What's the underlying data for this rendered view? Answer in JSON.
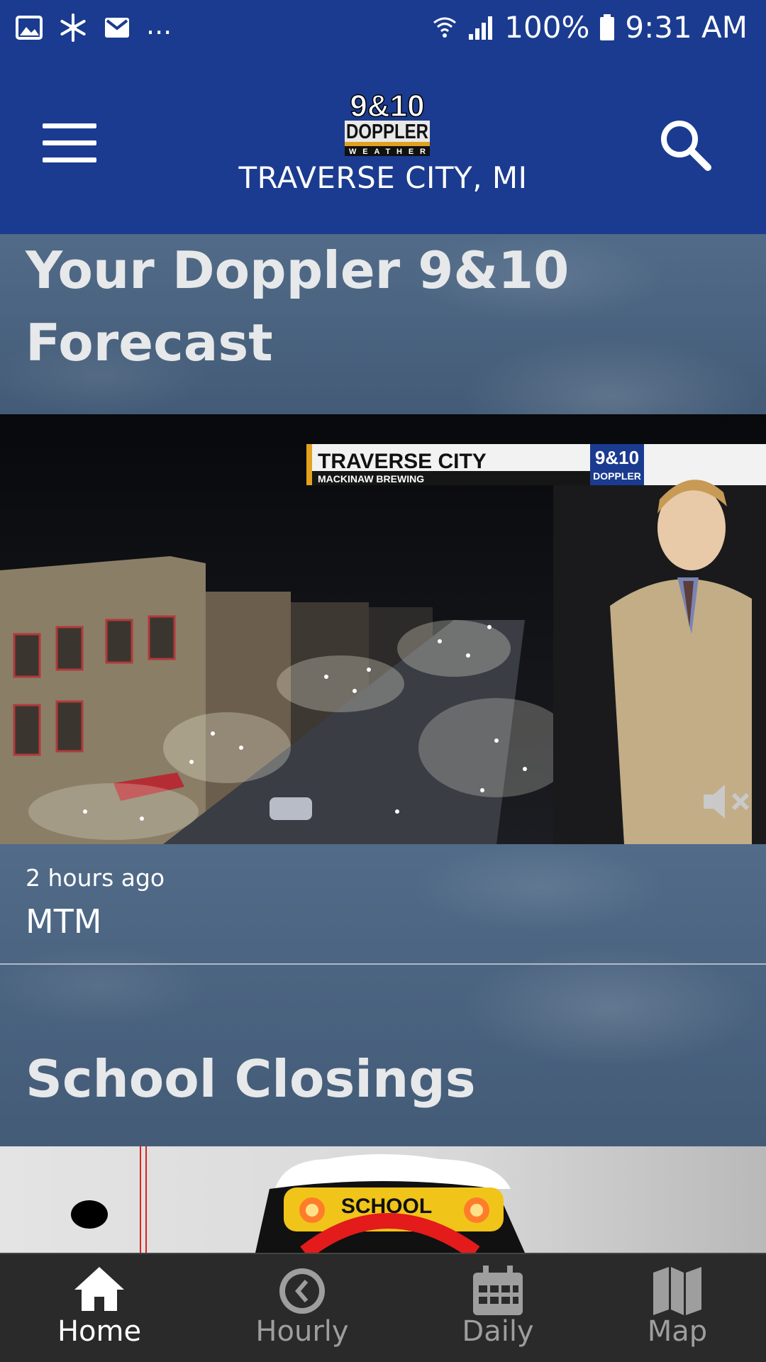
{
  "status_bar": {
    "battery": "100%",
    "time": "9:31 AM",
    "more": "..."
  },
  "header": {
    "logo_text": {
      "line1": "9&10",
      "line2": "DOPPLER",
      "line3": "WEATHER"
    },
    "location": "TRAVERSE CITY, MI"
  },
  "forecast": {
    "title_line1": "Your Doppler 9&10",
    "title_line2": "Forecast",
    "video": {
      "lower_third_title": "TRAVERSE CITY",
      "lower_third_sub": "MACKINAW BREWING",
      "channel_bug_line1": "9&10",
      "channel_bug_line2": "DOPPLER"
    },
    "time_ago": "2 hours ago",
    "video_title": "MTM"
  },
  "school_closings": {
    "title": "School Closings",
    "bus_sign": "SCHOOL"
  },
  "bottom_nav": {
    "items": [
      {
        "label": "Home",
        "icon": "home-icon",
        "active": true
      },
      {
        "label": "Hourly",
        "icon": "clock-icon",
        "active": false
      },
      {
        "label": "Daily",
        "icon": "calendar-icon",
        "active": false
      },
      {
        "label": "Map",
        "icon": "map-icon",
        "active": false
      }
    ]
  },
  "colors": {
    "brand_blue": "#1a3b8f",
    "sky": "#47607c",
    "nav_bg": "#2a2a2a"
  }
}
